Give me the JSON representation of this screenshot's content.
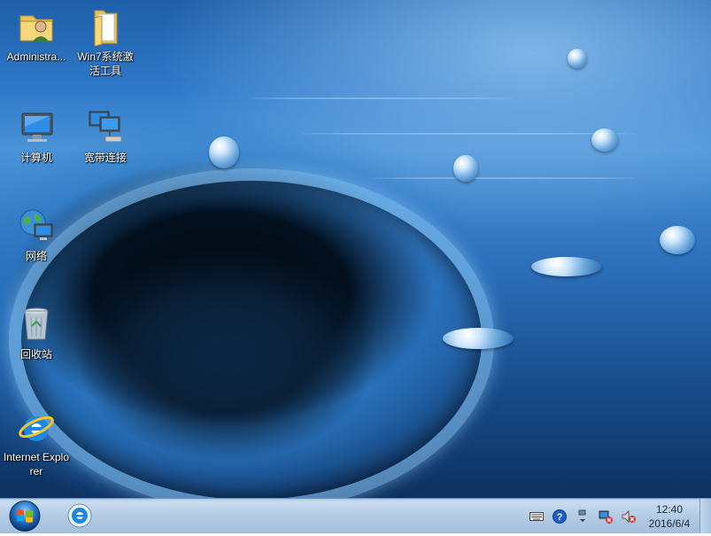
{
  "desktop": {
    "icons": [
      {
        "id": "administrator",
        "label": "Administra...",
        "icon": "user-folder-icon"
      },
      {
        "id": "win7-activation",
        "label": "Win7系统激活工具",
        "icon": "folder-icon"
      },
      {
        "id": "computer",
        "label": "计算机",
        "icon": "computer-icon"
      },
      {
        "id": "broadband",
        "label": "宽带连接",
        "icon": "network-connection-icon"
      },
      {
        "id": "network",
        "label": "网络",
        "icon": "network-globe-icon"
      },
      {
        "id": "recycle-bin",
        "label": "回收站",
        "icon": "recycle-bin-icon"
      },
      {
        "id": "internet-explorer",
        "label": "Internet Explorer",
        "icon": "internet-explorer-icon"
      }
    ]
  },
  "taskbar": {
    "start_icon": "windows-logo-icon",
    "pinned": [
      {
        "id": "ie",
        "icon": "internet-explorer-icon"
      }
    ],
    "tray": {
      "icons": [
        "keyboard-icon",
        "help-icon",
        "show-hidden-icons-icon",
        "network-error-icon",
        "volume-muted-icon"
      ],
      "time": "12:40",
      "date": "2016/6/4"
    }
  },
  "colors": {
    "taskbar_top": "#c9dcef",
    "taskbar_bottom": "#a3bfdc",
    "wallpaper_blue": "#2f79c9"
  }
}
